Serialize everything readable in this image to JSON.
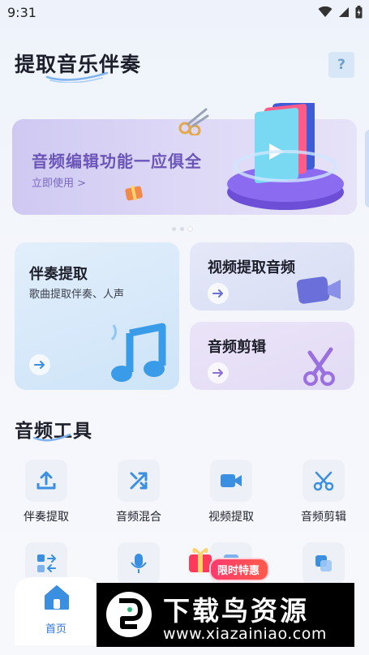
{
  "status_bar": {
    "time": "9:31"
  },
  "header": {
    "title": "提取音乐伴奏",
    "help_label": "?"
  },
  "banner": {
    "title": "音频编辑功能一应俱全",
    "link_label": "立即使用 >",
    "page_count": 3,
    "active_page": 3
  },
  "feature_cards": {
    "accompaniment": {
      "title": "伴奏提取",
      "subtitle": "歌曲提取伴奏、人声",
      "arrow": "→"
    },
    "video_audio": {
      "title": "视频提取音频",
      "arrow": "→"
    },
    "audio_cut": {
      "title": "音频剪辑",
      "arrow": "→"
    }
  },
  "tools_section": {
    "title": "音频工具",
    "tools": [
      {
        "label": "伴奏提取",
        "icon": "upload-icon"
      },
      {
        "label": "音频混合",
        "icon": "shuffle-icon"
      },
      {
        "label": "视频提取",
        "icon": "video-camera-icon"
      },
      {
        "label": "音频剪辑",
        "icon": "scissors-icon"
      }
    ],
    "second_row_icons": [
      "arrows-swap-icon",
      "microphone-icon",
      "audio-file-icon",
      "layers-icon"
    ]
  },
  "promo": {
    "label": "限时特惠"
  },
  "bottom_nav": {
    "home_label": "首页"
  },
  "watermark": {
    "text": "下载鸟资源",
    "url": "www.xiazainiao.com"
  },
  "colors": {
    "accent_blue": "#2f74e8",
    "banner_purple": "#6b55b8",
    "promo_red": "#ff3a6e"
  }
}
